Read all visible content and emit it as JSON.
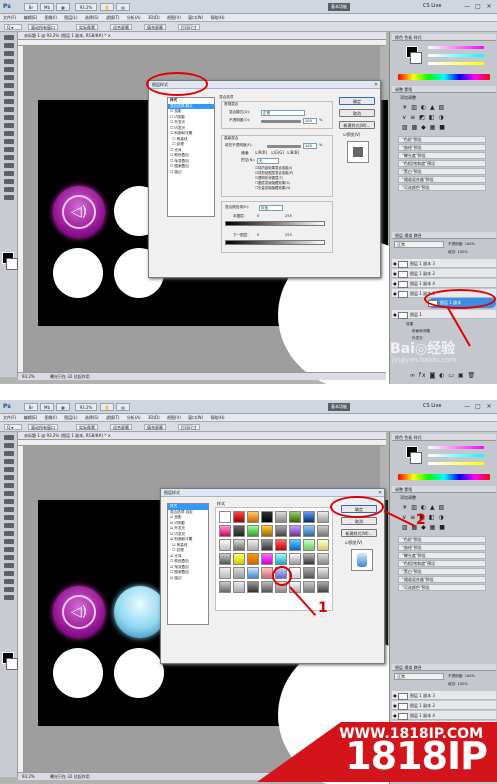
{
  "app": {
    "logo": "Ps",
    "zoom_value": "93.2%",
    "workspace_label": "基本功能",
    "cs_live_label": "CS Live",
    "window_buttons": [
      "—",
      "□",
      "✕"
    ]
  },
  "menu": {
    "items": [
      "文件(F)",
      "编辑(E)",
      "图像(I)",
      "图层(L)",
      "选择(S)",
      "滤镜(T)",
      "分析(A)",
      "3D(D)",
      "视图(V)",
      "窗口(W)",
      "帮助(H)"
    ]
  },
  "options_bar": {
    "items": [
      "滚动所有窗口",
      "实际像素",
      "适合屏幕",
      "填充屏幕",
      "打印尺寸"
    ]
  },
  "document": {
    "tab_label": "未标题-1 @ 93.2% (图层 1 副本, RGB/8#) * ✕",
    "status_1": "93.2%",
    "status_doc": "曝光只在 32 位起作用",
    "status_2": "93.2%",
    "status_doc2": "曝光只在 32 位起作用"
  },
  "panels": {
    "color_tabs": [
      "颜色",
      "色板",
      "样式"
    ],
    "adjust_tabs": [
      "调整",
      "蒙版"
    ],
    "adjust_title": "添加调整",
    "presets": [
      "\"色阶\"预设",
      "\"曲线\"预设",
      "\"曝光度\"预设",
      "\"色相/饱和度\"预设",
      "\"黑白\"预设",
      "\"通道混合器\"预设",
      "\"可选颜色\"预设"
    ],
    "layers_tabs": [
      "图层",
      "通道",
      "路径"
    ],
    "blend_mode": "正常",
    "opacity_label": "不透明度: 100%",
    "fill_label": "填充: 100%",
    "layers": [
      {
        "name": "图层 1 副本 3"
      },
      {
        "name": "图层 1 副本 2"
      },
      {
        "name": "图层 1 副本 4"
      },
      {
        "name": "图层 1 副本 5"
      },
      {
        "name": "图层 1 副本"
      },
      {
        "name": "图层 1"
      }
    ],
    "effects_label": "效果",
    "effect_items": [
      "斜面和浮雕",
      "外发光"
    ]
  },
  "dialog1": {
    "title": "图层样式",
    "list_header": "样式",
    "list_items": [
      "混合选项:默认",
      "投影",
      "内阴影",
      "外发光",
      "内发光",
      "斜面和浮雕",
      "等高线",
      "纹理",
      "光泽",
      "颜色叠加",
      "渐变叠加",
      "图案叠加",
      "描边"
    ],
    "section_blend": "混合选项",
    "section_general": "常规混合",
    "blend_mode_label": "混合模式(D):",
    "blend_mode_value": "正常",
    "opacity_label": "不透明度(O):",
    "opacity_value": "100",
    "percent": "%",
    "section_advanced": "高级混合",
    "fill_opacity_label": "填充不透明度(F):",
    "fill_opacity_value": "100",
    "channels_label": "通道:",
    "channels": [
      "R(R)",
      "G(G)",
      "B(B)"
    ],
    "knockout_label": "挖空(N):",
    "knockout_value": "无",
    "adv_options": [
      "将内部效果混合成组(I)",
      "将剪贴图层混合成组(P)",
      "透明形状图层(T)",
      "图层蒙版隐藏效果(S)",
      "矢量蒙版隐藏效果(H)"
    ],
    "blend_if_label": "混合颜色带(E):",
    "blend_if_value": "灰色",
    "this_layer_label": "本图层:",
    "under_layer_label": "下一图层:",
    "range_low": "0",
    "range_high": "255",
    "btn_ok": "确定",
    "btn_cancel": "取消",
    "btn_new_style": "新建样式(W)...",
    "preview_label": "预览(V)"
  },
  "dialog2": {
    "title": "图层样式",
    "list_header": "样式",
    "list_items": [
      "混合选项:自定",
      "投影",
      "内阴影",
      "外发光",
      "内发光",
      "斜面和浮雕",
      "等高线",
      "纹理",
      "光泽",
      "颜色叠加",
      "渐变叠加",
      "图案叠加",
      "描边"
    ],
    "checked_items": [
      "投影",
      "内阴影",
      "外发光",
      "内发光",
      "斜面和浮雕",
      "等高线",
      "光泽",
      "渐变叠加",
      "描边"
    ],
    "styles_header": "样式",
    "btn_ok": "确定",
    "btn_cancel": "取消",
    "btn_new_style": "新建样式(W)...",
    "preview_label": "预览(V)"
  },
  "annotations": {
    "num_1": "1",
    "num_2": "2",
    "color": "#e00000"
  },
  "watermark": {
    "baidu": "Bai◎经验",
    "baidu_sub": "jingyan.baidu.com",
    "url": "WWW.1818IP.COM",
    "big": "1818IP",
    "band_color": "#d4141b"
  }
}
